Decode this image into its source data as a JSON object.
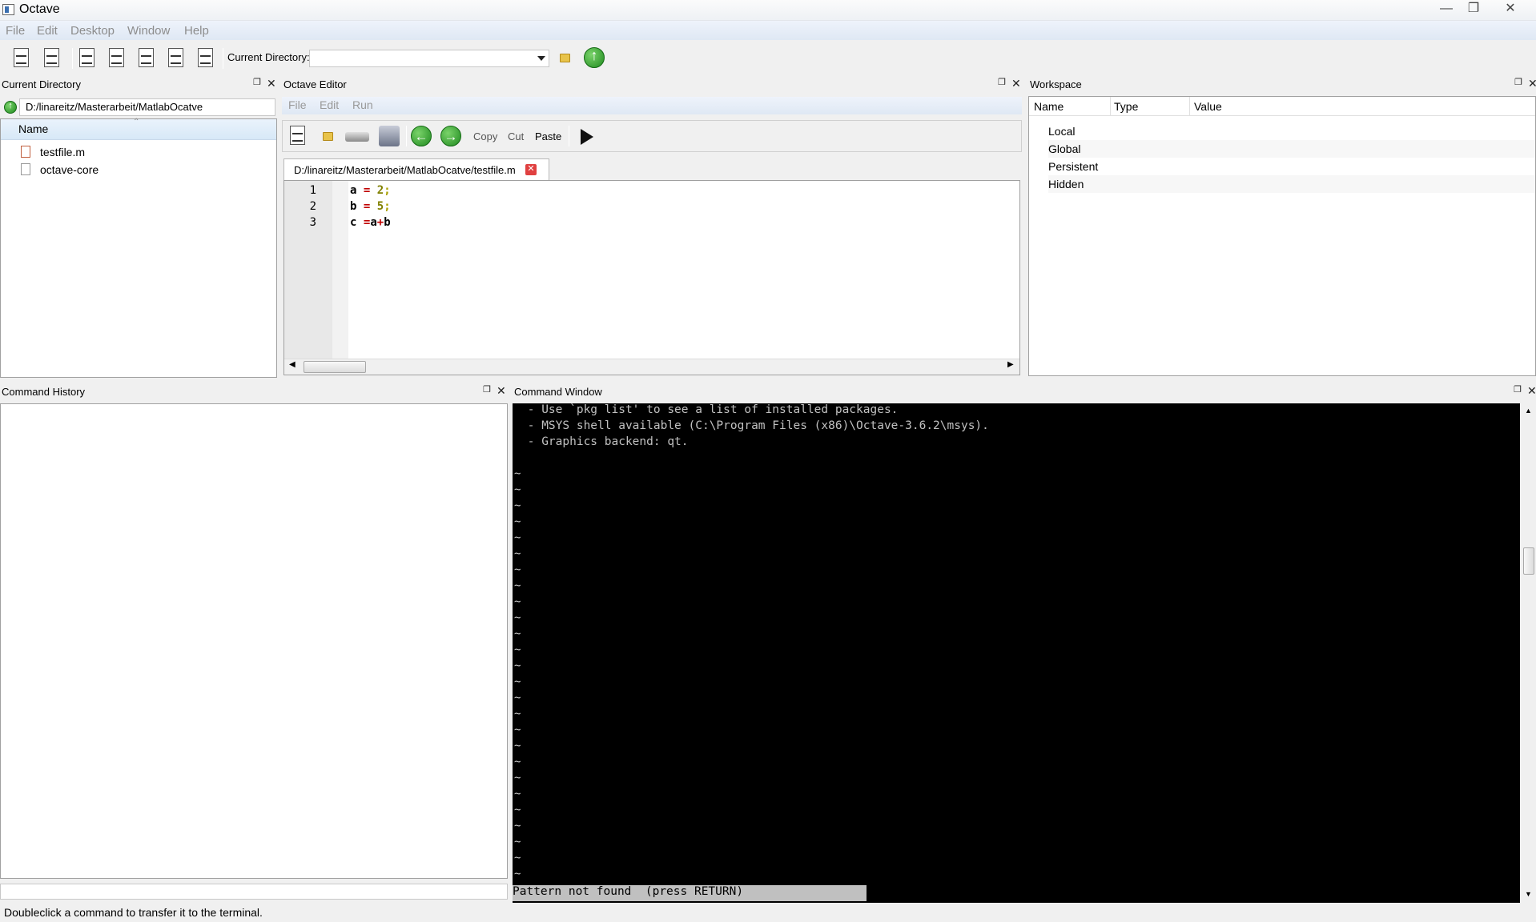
{
  "window": {
    "title": "Octave"
  },
  "menubar": {
    "items": [
      "File",
      "Edit",
      "Desktop",
      "Window",
      "Help"
    ]
  },
  "toolbar": {
    "current_directory_label": "Current Directory:",
    "current_directory_value": ""
  },
  "current_directory_panel": {
    "title": "Current Directory",
    "path": "D:/linareitz/Masterarbeit/MatlabOcatve",
    "column_header": "Name",
    "files": [
      "testfile.m",
      "octave-core"
    ]
  },
  "editor": {
    "title": "Octave Editor",
    "menu": [
      "File",
      "Edit",
      "Run"
    ],
    "buttons": {
      "copy": "Copy",
      "cut": "Cut",
      "paste": "Paste"
    },
    "tab_label": "D:/linareitz/Masterarbeit/MatlabOcatve/testfile.m",
    "line_numbers": [
      "1",
      "2",
      "3"
    ],
    "code": {
      "l1": {
        "var": "a",
        "op": "=",
        "num": "2",
        "end": ";"
      },
      "l2": {
        "var": "b",
        "op": "=",
        "num": "5",
        "end": ";"
      },
      "l3": {
        "var": "c",
        "op": "=",
        "a": "a",
        "plus": "+",
        "b": "b"
      }
    }
  },
  "workspace": {
    "title": "Workspace",
    "columns": [
      "Name",
      "Type",
      "Value"
    ],
    "rows": [
      "Local",
      "Global",
      "Persistent",
      "Hidden"
    ]
  },
  "history": {
    "title": "Command History",
    "status": "Doubleclick a command to transfer it to the terminal."
  },
  "command_window": {
    "title": "Command Window",
    "lines": [
      " - Use `pkg list' to see a list of installed packages.",
      " - MSYS shell available (C:\\Program Files (x86)\\Octave-3.6.2\\msys).",
      " - Graphics backend: qt."
    ],
    "tilde": "~",
    "pager_prompt": "Pattern not found  (press RETURN)"
  },
  "colors": {
    "console_bg": "#000000",
    "console_fg": "#c0c0c0",
    "accent_green": "#1f8a1f",
    "tab_close": "#e04040"
  }
}
